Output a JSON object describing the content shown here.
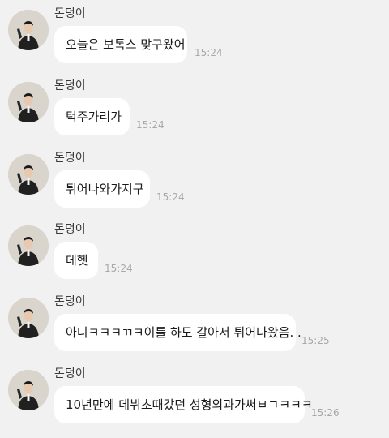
{
  "messages": [
    {
      "sender": "돈덩이",
      "text": "오늘은 보톡스 맞구왔어",
      "time": "15:24",
      "avatar_icon": "profile-photo"
    },
    {
      "sender": "돈덩이",
      "text": "턱주가리가",
      "time": "15:24",
      "avatar_icon": "profile-photo"
    },
    {
      "sender": "돈덩이",
      "text": "튀어나와가지구",
      "time": "15:24",
      "avatar_icon": "profile-photo"
    },
    {
      "sender": "돈덩이",
      "text": "데헷",
      "time": "15:24",
      "avatar_icon": "profile-photo"
    },
    {
      "sender": "돈덩이",
      "text": "아니ㅋㅋㅋㄲㅋ이를 하도 갈아서 튀어나왔음. .",
      "time": "15:25",
      "avatar_icon": "profile-photo"
    },
    {
      "sender": "돈덩이",
      "text": "10년만에 데뷔초때갔던 성형외과가써ㅂㄱㅋㅋㅋ",
      "time": "15:26",
      "avatar_icon": "profile-photo"
    }
  ],
  "colors": {
    "background": "#f1f1f1",
    "bubble": "#ffffff",
    "timestamp": "#a8a8a8"
  }
}
